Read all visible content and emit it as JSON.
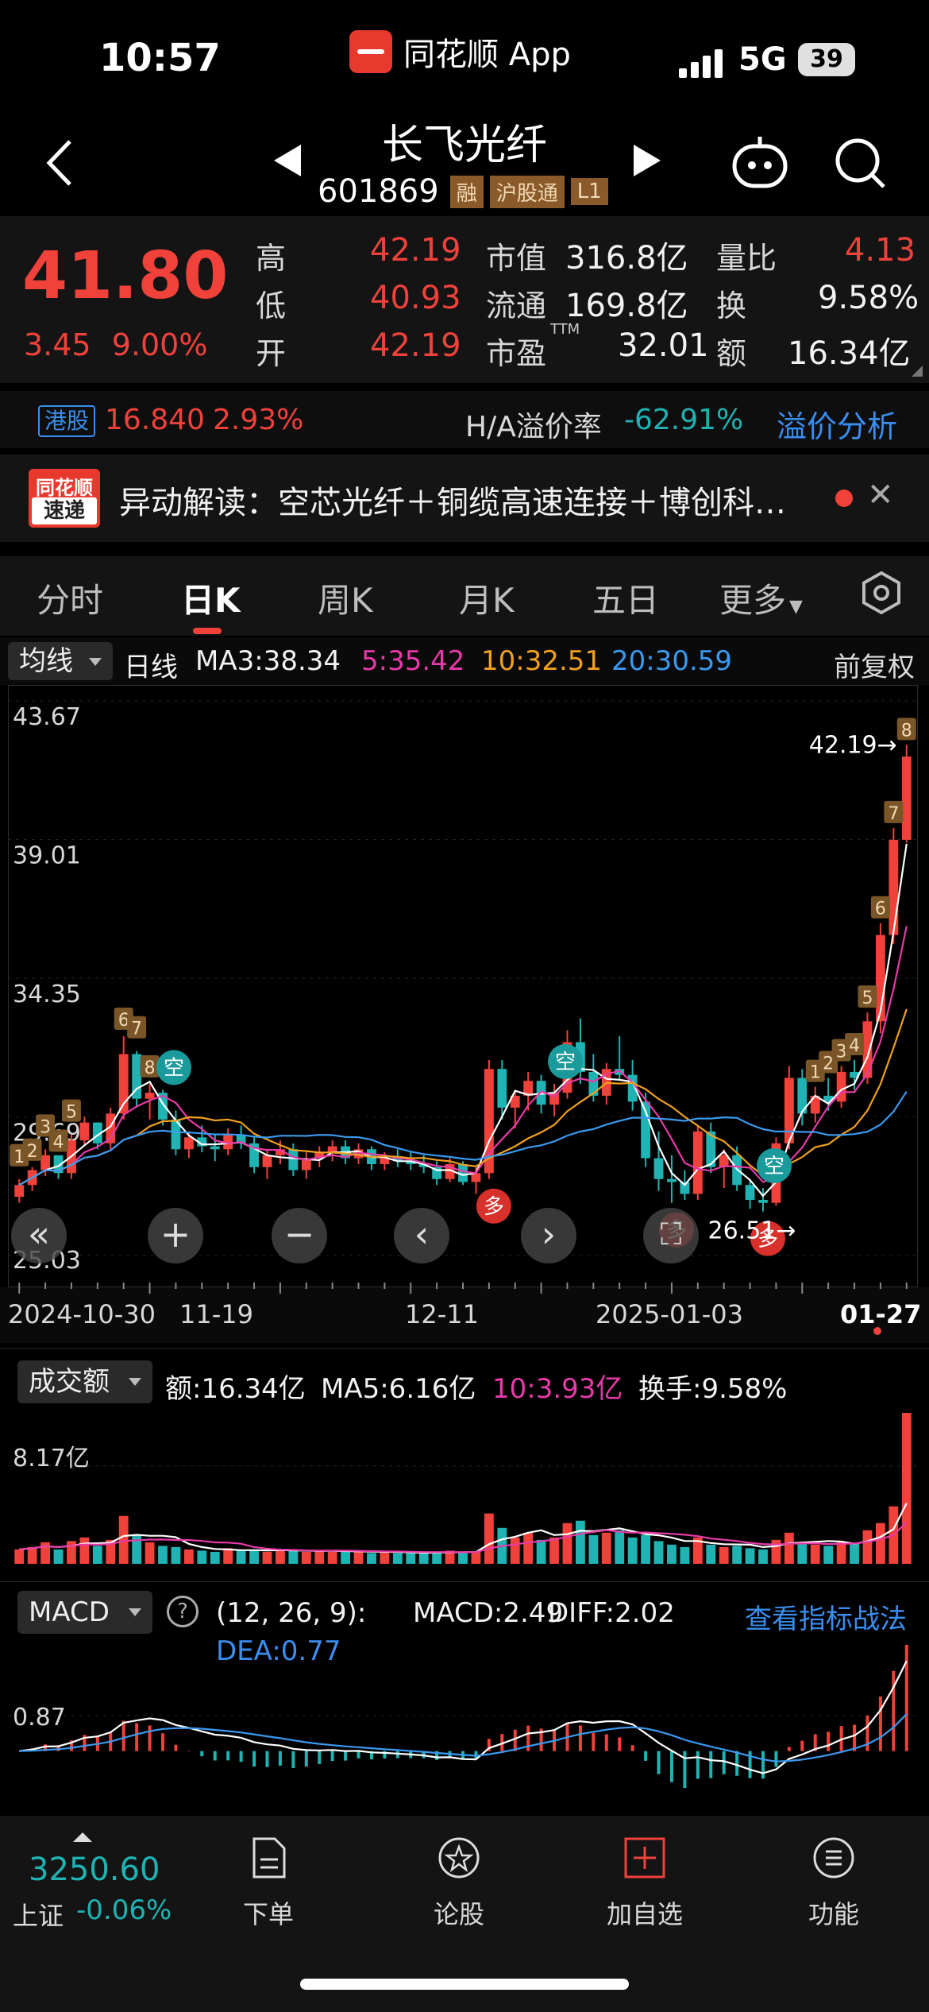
{
  "status_bar": {
    "time": "10:57",
    "app_name": "同花顺 App",
    "network": "5G",
    "battery": "39"
  },
  "stock": {
    "name": "长飞光纤",
    "code": "601869",
    "tags": [
      "融",
      "沪股通",
      "L1"
    ],
    "price": "41.80",
    "change_abs": "3.45",
    "change_pct": "9.00%",
    "stats": [
      {
        "label": "高",
        "value": "42.19"
      },
      {
        "label": "低",
        "value": "40.93"
      },
      {
        "label": "开",
        "value": "42.19"
      },
      {
        "label": "市值",
        "value": "316.8亿"
      },
      {
        "label": "流通",
        "value": "169.8亿"
      },
      {
        "label": "市盈",
        "sup": "TTM",
        "value": "32.01"
      },
      {
        "label": "量比",
        "value": "4.13"
      },
      {
        "label": "换",
        "value": "9.58%"
      },
      {
        "label": "额",
        "value": "16.34亿"
      }
    ]
  },
  "hk_row": {
    "tag": "港股",
    "hk_price": "16.840",
    "hk_pct": "2.93%",
    "premium_label": "H/A溢价率",
    "premium_value": "-62.91%",
    "analysis_link": "溢价分析"
  },
  "news": {
    "logo_top": "同花顺",
    "logo_bottom": "速递",
    "text": "异动解读：空芯光纤＋铜缆高速连接＋博创科…"
  },
  "tabs": [
    "分时",
    "日K",
    "周K",
    "月K",
    "五日",
    "更多"
  ],
  "active_tab": "日K",
  "chart_header": {
    "ma_select": "均线",
    "period": "日线",
    "ma3": "MA3:38.34",
    "ma5": "5:35.42",
    "ma10": "10:32.51",
    "ma20": "20:30.59",
    "adjust": "前复权"
  },
  "colors": {
    "up": "#f0413b",
    "down": "#1fb3b3",
    "ma3": "#ffffff",
    "ma5": "#e83aa8",
    "ma10": "#f0a020",
    "ma20": "#3a9af0"
  },
  "chart_data": [
    {
      "type": "candlestick",
      "title": "日K",
      "yticks": [
        "43.67",
        "39.01",
        "34.35",
        "29.69",
        "25.03"
      ],
      "ylim": [
        25.03,
        43.67
      ],
      "x_labels": [
        "2024-10-30",
        "11-19",
        "12-11",
        "2025-01-03",
        "01-27"
      ],
      "annotations": {
        "high_marker": "42.19→",
        "low_marker": "26.51→",
        "buy_signal": "多",
        "sell_signal": "空"
      },
      "seq_labels": [
        "1",
        "2",
        "3",
        "4",
        "5",
        "6",
        "7",
        "8"
      ],
      "ohlc": [
        [
          27.0,
          27.6,
          26.8,
          27.4
        ],
        [
          27.4,
          28.0,
          27.2,
          27.9
        ],
        [
          27.9,
          28.6,
          27.7,
          28.4
        ],
        [
          28.4,
          28.3,
          27.6,
          27.8
        ],
        [
          27.8,
          29.1,
          27.6,
          28.9
        ],
        [
          28.9,
          29.7,
          28.7,
          29.5
        ],
        [
          29.5,
          29.5,
          28.6,
          28.8
        ],
        [
          28.8,
          30.0,
          28.6,
          29.8
        ],
        [
          29.8,
          32.4,
          29.6,
          31.8
        ],
        [
          31.8,
          31.9,
          30.0,
          30.3
        ],
        [
          30.3,
          30.8,
          29.6,
          30.5
        ],
        [
          30.5,
          30.6,
          29.4,
          29.6
        ],
        [
          29.6,
          29.9,
          28.4,
          28.6
        ],
        [
          28.6,
          29.2,
          28.3,
          29.0
        ],
        [
          29.0,
          29.4,
          28.5,
          28.7
        ],
        [
          28.7,
          29.1,
          28.2,
          28.6
        ],
        [
          28.6,
          29.3,
          28.4,
          29.1
        ],
        [
          29.1,
          29.4,
          28.6,
          28.8
        ],
        [
          28.8,
          29.0,
          27.8,
          28.0
        ],
        [
          28.0,
          28.6,
          27.6,
          28.4
        ],
        [
          28.4,
          28.9,
          28.1,
          28.6
        ],
        [
          28.6,
          28.8,
          27.7,
          27.9
        ],
        [
          27.9,
          28.5,
          27.6,
          28.3
        ],
        [
          28.3,
          28.7,
          28.0,
          28.5
        ],
        [
          28.5,
          28.9,
          28.2,
          28.7
        ],
        [
          28.7,
          28.9,
          28.1,
          28.3
        ],
        [
          28.3,
          28.8,
          28.1,
          28.6
        ],
        [
          28.6,
          28.7,
          27.9,
          28.1
        ],
        [
          28.1,
          28.5,
          27.9,
          28.3
        ],
        [
          28.3,
          28.6,
          28.0,
          28.2
        ],
        [
          28.2,
          28.5,
          27.9,
          28.1
        ],
        [
          28.1,
          28.4,
          27.8,
          28.0
        ],
        [
          28.0,
          28.2,
          27.4,
          27.6
        ],
        [
          27.6,
          28.3,
          27.5,
          28.1
        ],
        [
          28.1,
          28.2,
          27.4,
          27.5
        ],
        [
          27.5,
          28.0,
          27.1,
          27.8
        ],
        [
          27.8,
          31.6,
          27.6,
          31.3
        ],
        [
          31.3,
          31.6,
          29.6,
          30.0
        ],
        [
          30.0,
          30.6,
          29.3,
          30.4
        ],
        [
          30.4,
          31.2,
          29.9,
          30.9
        ],
        [
          30.9,
          31.1,
          29.8,
          30.1
        ],
        [
          30.1,
          30.8,
          29.7,
          30.5
        ],
        [
          30.5,
          32.6,
          30.3,
          32.2
        ],
        [
          32.2,
          33.0,
          30.8,
          31.2
        ],
        [
          31.2,
          31.8,
          30.2,
          30.4
        ],
        [
          30.4,
          31.5,
          30.1,
          31.3
        ],
        [
          31.3,
          32.4,
          30.9,
          31.1
        ],
        [
          31.1,
          31.6,
          29.9,
          30.2
        ],
        [
          30.2,
          30.5,
          28.0,
          28.3
        ],
        [
          28.3,
          29.2,
          27.2,
          27.6
        ],
        [
          27.6,
          28.4,
          26.8,
          27.5
        ],
        [
          27.5,
          27.9,
          26.9,
          27.1
        ],
        [
          27.1,
          29.4,
          26.9,
          29.2
        ],
        [
          29.2,
          29.5,
          27.8,
          28.0
        ],
        [
          28.0,
          28.6,
          27.3,
          28.4
        ],
        [
          28.4,
          28.7,
          27.2,
          27.4
        ],
        [
          27.4,
          27.6,
          26.6,
          26.9
        ],
        [
          26.9,
          27.3,
          26.51,
          26.8
        ],
        [
          26.8,
          29.0,
          26.7,
          28.8
        ],
        [
          28.8,
          31.4,
          28.6,
          31.0
        ],
        [
          31.0,
          31.3,
          29.4,
          29.8
        ],
        [
          29.8,
          30.7,
          29.5,
          30.4
        ],
        [
          30.4,
          31.0,
          29.9,
          30.2
        ],
        [
          30.2,
          31.4,
          30.0,
          31.2
        ],
        [
          31.2,
          31.6,
          30.6,
          31.0
        ],
        [
          31.0,
          33.2,
          30.8,
          32.9
        ],
        [
          32.9,
          36.2,
          32.5,
          35.8
        ],
        [
          35.8,
          39.4,
          35.5,
          39.0
        ],
        [
          39.0,
          42.19,
          38.9,
          41.8
        ]
      ]
    },
    {
      "type": "bar",
      "title": "成交额",
      "yticks": [
        "8.17亿"
      ],
      "unit": "亿",
      "series": [
        {
          "name": "额",
          "values": [
            1.2,
            1.4,
            1.8,
            1.2,
            1.9,
            2.2,
            1.5,
            2.0,
            4.0,
            2.4,
            1.8,
            1.5,
            1.4,
            1.2,
            1.1,
            1.0,
            1.3,
            1.1,
            1.2,
            1.0,
            1.1,
            1.2,
            1.0,
            1.1,
            1.0,
            1.0,
            1.1,
            0.9,
            1.0,
            0.9,
            0.9,
            0.9,
            1.0,
            1.1,
            0.9,
            1.0,
            4.2,
            3.0,
            2.2,
            2.6,
            2.0,
            2.2,
            3.4,
            3.6,
            2.4,
            2.6,
            2.8,
            2.2,
            2.4,
            1.9,
            1.6,
            1.4,
            2.2,
            1.6,
            1.4,
            1.5,
            1.3,
            1.2,
            2.0,
            2.6,
            1.8,
            1.6,
            1.5,
            1.8,
            1.7,
            2.8,
            3.4,
            4.8,
            12.6
          ]
        }
      ]
    },
    {
      "type": "macd",
      "title": "MACD",
      "yticks": [
        "0.87"
      ]
    }
  ],
  "volume": {
    "select": "成交额",
    "amount": "额:16.34亿",
    "ma5": "MA5:6.16亿",
    "ma10": "10:3.93亿",
    "turnover": "换手:9.58%"
  },
  "macd": {
    "select": "MACD",
    "params": "(12, 26, 9):",
    "macd_val": "MACD:2.49",
    "diff": "DIFF:2.02",
    "dea": "DEA:0.77",
    "link": "查看指标战法"
  },
  "bottom": {
    "index_value": "3250.60",
    "index_name": "上证",
    "index_pct": "-0.06%",
    "nav": [
      "下单",
      "论股",
      "加自选",
      "功能"
    ]
  }
}
